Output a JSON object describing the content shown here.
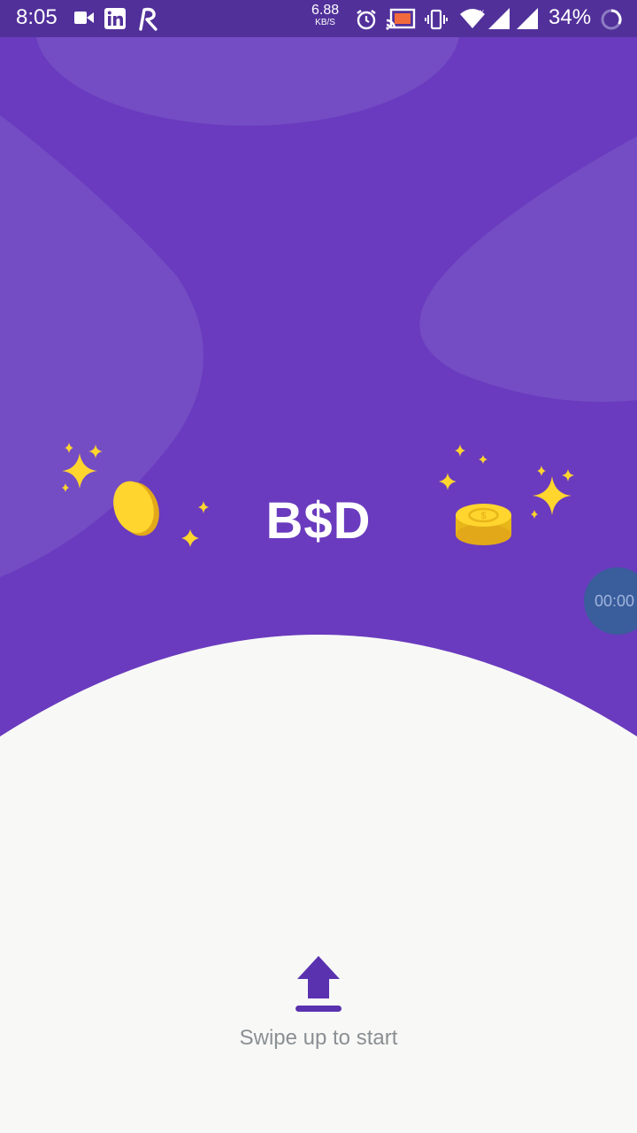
{
  "status_bar": {
    "time": "8:05",
    "net_speed": "6.88",
    "net_unit": "KB/S",
    "battery": "34%",
    "icons": [
      "video-icon",
      "linkedin-icon",
      "r-app-icon",
      "alarm-icon",
      "cast-icon",
      "vibrate-icon",
      "wifi-icon",
      "signal-icon",
      "signal-icon",
      "battery-ring-icon"
    ]
  },
  "hero": {
    "logo_text": "B$D",
    "bg_color": "#6A3BBE",
    "accent_yellow": "#FFD52E"
  },
  "floating_timer": "00:00",
  "swipe": {
    "label": "Swipe up to start",
    "icon": "upload-arrow-icon",
    "color": "#5A32B0"
  }
}
